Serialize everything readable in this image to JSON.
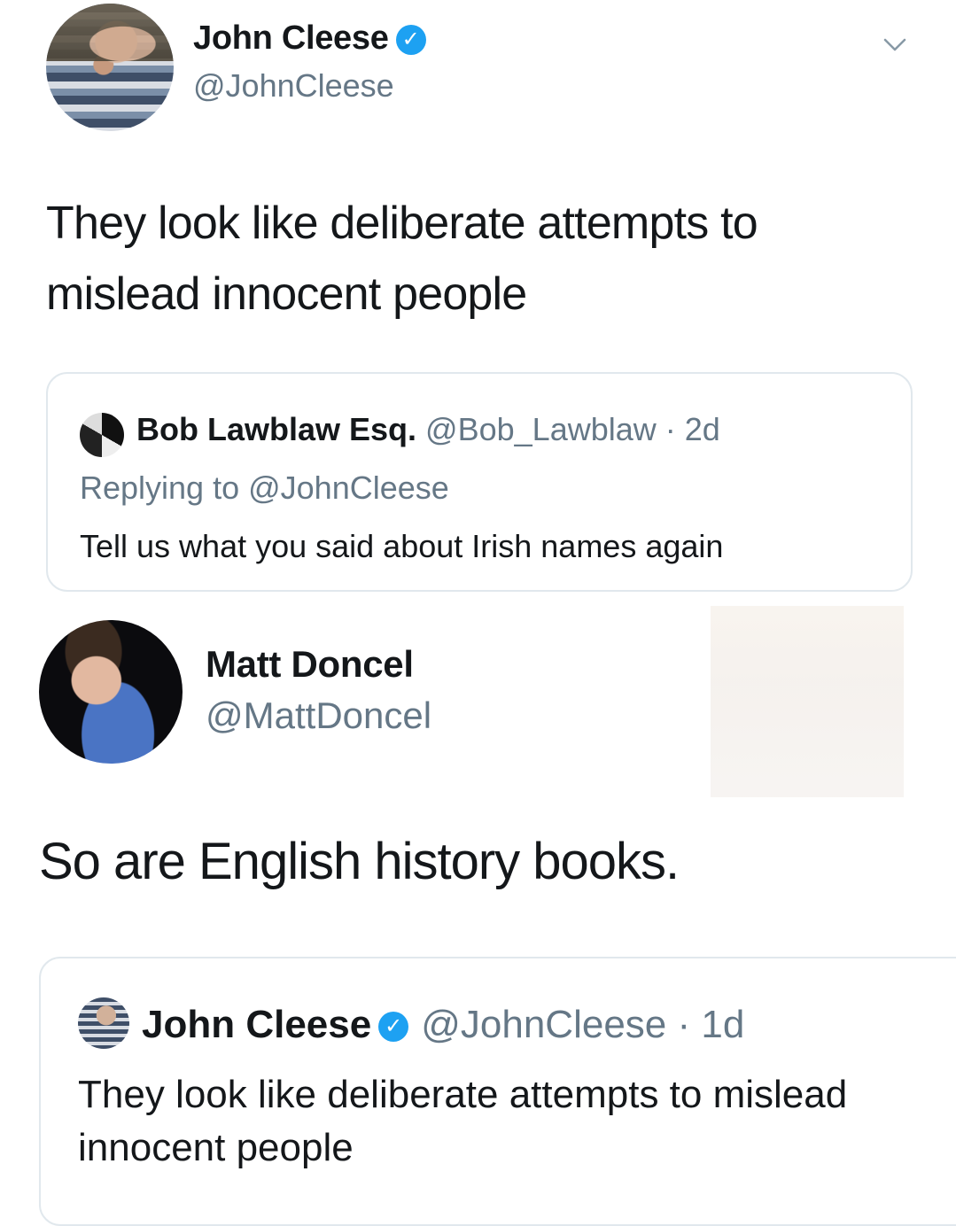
{
  "tweet1": {
    "name": "John Cleese",
    "handle": "@JohnCleese",
    "text": "They look like deliberate attempts to mislead innocent people",
    "verified_icon": "verified-badge-icon",
    "menu_icon": "chevron-down-icon"
  },
  "quote1": {
    "name": "Bob Lawblaw Esq.",
    "handle": "@Bob_Lawblaw",
    "time": "· 2d",
    "replying": "Replying to @JohnCleese",
    "text": "Tell us what you said about Irish names again"
  },
  "tweet2": {
    "name": "Matt Doncel",
    "handle": "@MattDoncel",
    "text": "So are English history books."
  },
  "quote2": {
    "name": "John Cleese",
    "handle": "@JohnCleese",
    "time": "· 1d",
    "text": "They look like deliberate attempts to mislead innocent people"
  },
  "colors": {
    "accent": "#1da1f2",
    "muted": "#657786",
    "text": "#14171a",
    "border": "#e1e8ed"
  }
}
